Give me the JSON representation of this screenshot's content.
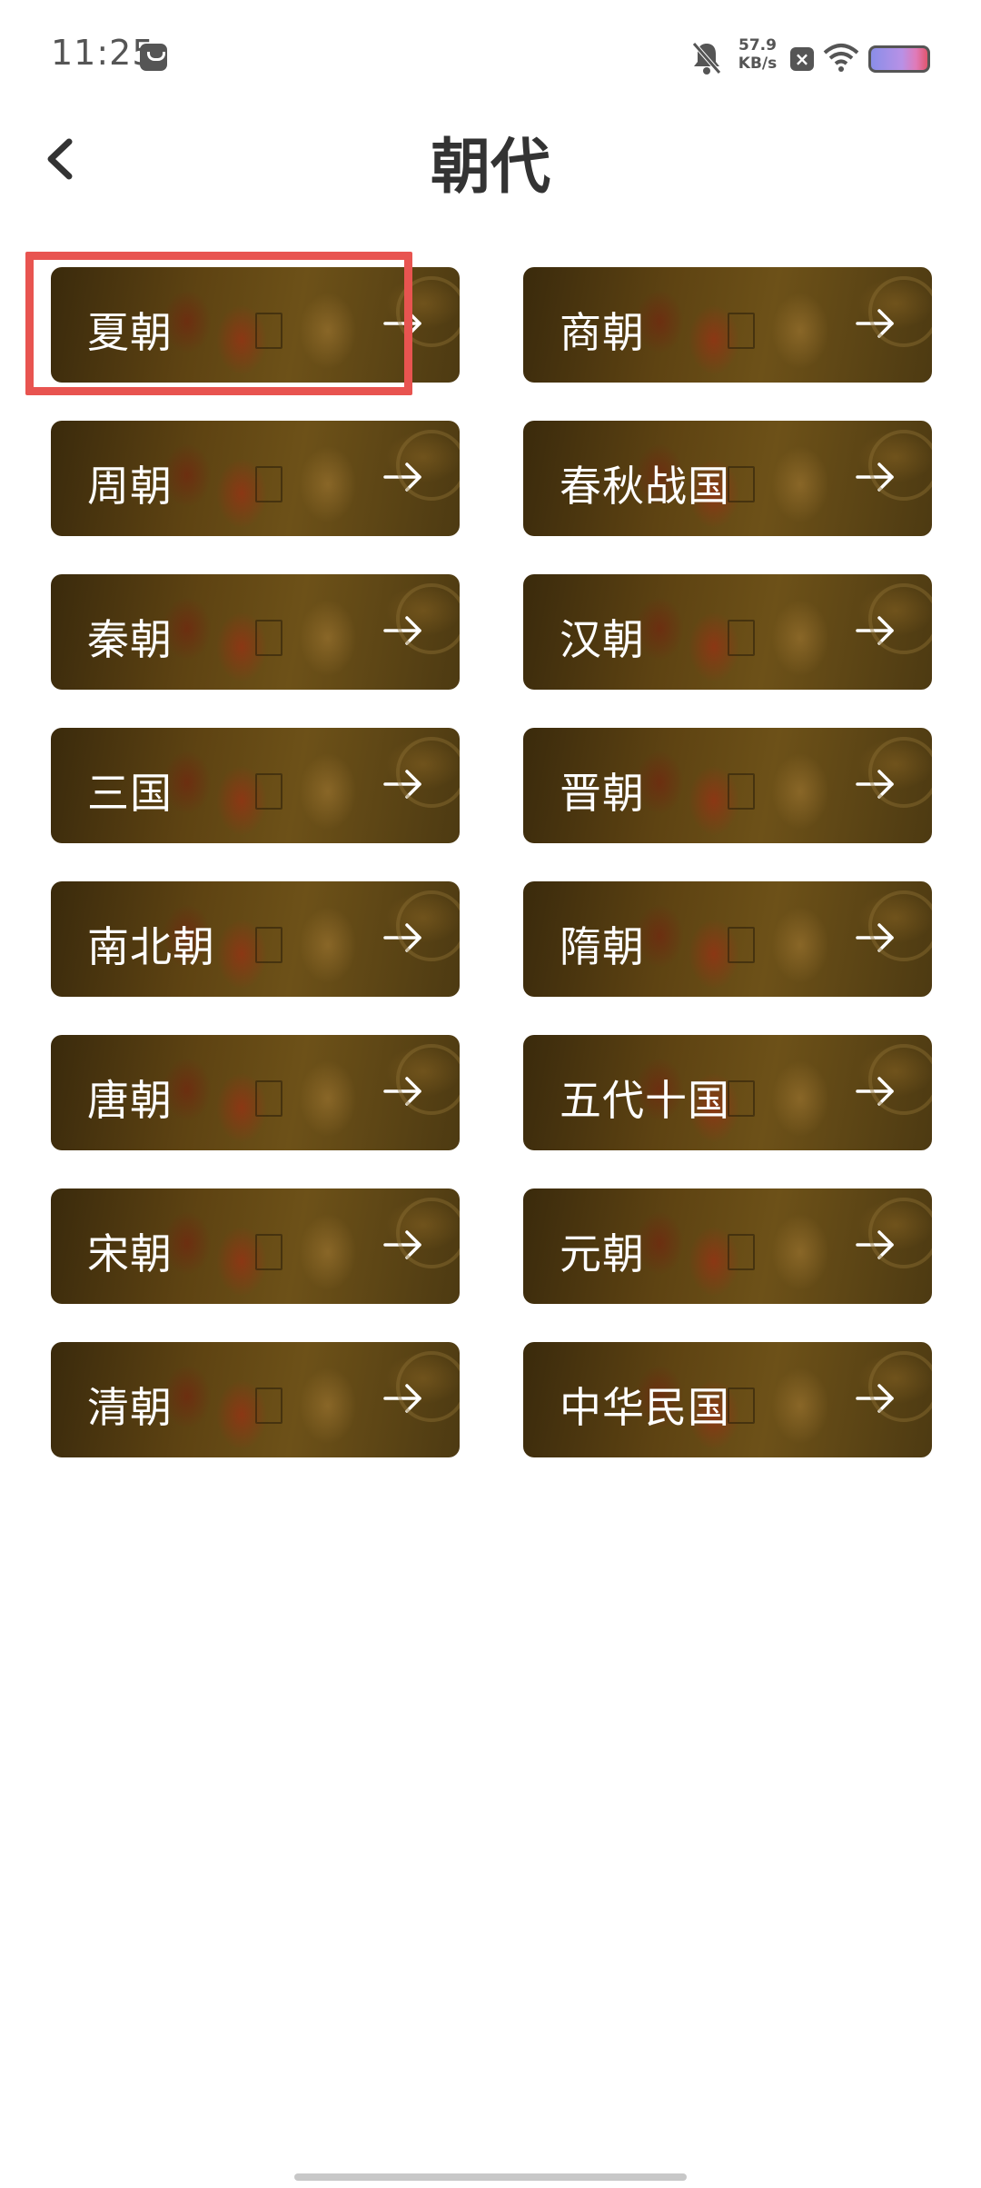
{
  "status_bar": {
    "time": "11:25",
    "speed_value": "57.9",
    "speed_unit": "KB/s",
    "icons": [
      "message-icon",
      "bell-off-icon",
      "x-box-icon",
      "wifi-icon",
      "battery-icon"
    ]
  },
  "header": {
    "title": "朝代",
    "back_icon": "chevron-left-icon"
  },
  "dynasties": [
    "夏朝",
    "商朝",
    "周朝",
    "春秋战国",
    "秦朝",
    "汉朝",
    "三国",
    "晋朝",
    "南北朝",
    "隋朝",
    "唐朝",
    "五代十国",
    "宋朝",
    "元朝",
    "清朝",
    "中华民国"
  ],
  "colors": {
    "highlight": "#e85450",
    "title": "#333333",
    "card_text": "#ffffff"
  }
}
